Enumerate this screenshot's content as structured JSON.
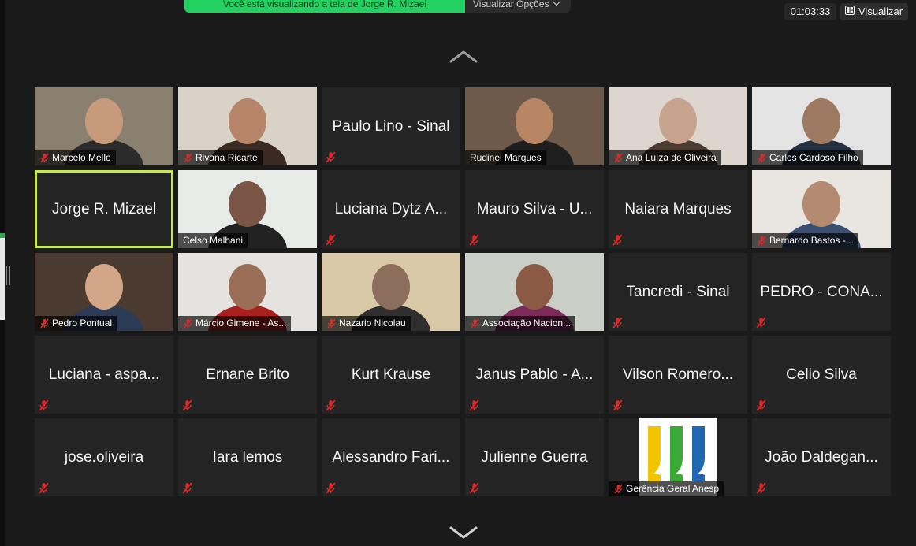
{
  "banner": {
    "sharing_text": "Você está visualizando a tela de Jorge R. Mizael",
    "view_options_label": "Visualizar Opções"
  },
  "timer": "01:03:33",
  "view_button_label": "Visualizar",
  "colors": {
    "background": "#1a1a1a",
    "tile": "#242424",
    "share_green": "#23d160",
    "active_speaker": "#c6e84f",
    "muted_red": "#e02828"
  },
  "participants": [
    {
      "name": "Marcelo Mello",
      "video": true,
      "muted": true
    },
    {
      "name": "Rivana Ricarte",
      "video": true,
      "muted": true
    },
    {
      "name": "Paulo Lino - Sinal",
      "video": false,
      "muted": true
    },
    {
      "name": "Rudinei Marques",
      "video": true,
      "muted": false
    },
    {
      "name": "Ana Luíza de Oliveira",
      "video": true,
      "muted": true
    },
    {
      "name": "Carlos Cardoso Filho",
      "video": true,
      "muted": true
    },
    {
      "name": "Jorge R. Mizael",
      "video": false,
      "muted": false,
      "active": true
    },
    {
      "name": "Celso Malhani",
      "video": true,
      "muted": false
    },
    {
      "name": "Luciana Dytz A...",
      "video": false,
      "muted": true
    },
    {
      "name": "Mauro Silva - U...",
      "video": false,
      "muted": true
    },
    {
      "name": "Naiara Marques",
      "video": false,
      "muted": true
    },
    {
      "name": "Bernardo Bastos -...",
      "video": true,
      "muted": true
    },
    {
      "name": "Pedro Pontual",
      "video": true,
      "muted": true
    },
    {
      "name": "Márcio Gimene - As...",
      "video": true,
      "muted": true
    },
    {
      "name": "Nazario Nicolau",
      "video": true,
      "muted": true
    },
    {
      "name": "Associação Nacion...",
      "video": true,
      "muted": true
    },
    {
      "name": "Tancredi - Sinal",
      "video": false,
      "muted": true
    },
    {
      "name": "PEDRO - CONA...",
      "video": false,
      "muted": true
    },
    {
      "name": "Luciana -  aspa...",
      "video": false,
      "muted": true
    },
    {
      "name": "Ernane Brito",
      "video": false,
      "muted": true
    },
    {
      "name": "Kurt Krause",
      "video": false,
      "muted": true
    },
    {
      "name": "Janus Pablo - A...",
      "video": false,
      "muted": true
    },
    {
      "name": "Vilson Romero...",
      "video": false,
      "muted": true
    },
    {
      "name": "Celio Silva",
      "video": false,
      "muted": true
    },
    {
      "name": "jose.oliveira",
      "video": false,
      "muted": true
    },
    {
      "name": "Iara lemos",
      "video": false,
      "muted": true
    },
    {
      "name": "Alessandro Fari...",
      "video": false,
      "muted": true
    },
    {
      "name": "Julienne Guerra",
      "video": false,
      "muted": true
    },
    {
      "name": "Gerência Geral Anesp",
      "video": true,
      "muted": true,
      "logo": true
    },
    {
      "name": "João Daldegan...",
      "video": false,
      "muted": true
    }
  ]
}
